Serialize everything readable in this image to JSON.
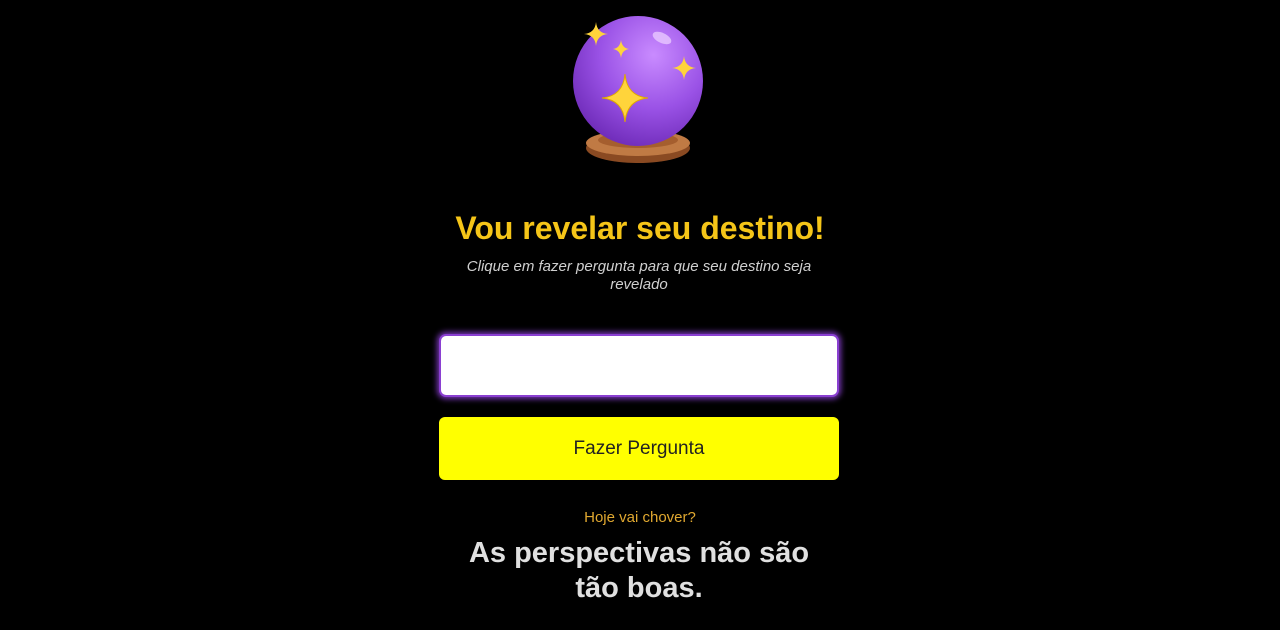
{
  "header": {
    "icon": "crystal-ball-icon",
    "title": "Vou revelar seu destino!",
    "subtitle": "Clique em fazer pergunta para que seu destino seja revelado"
  },
  "form": {
    "question_value": "",
    "question_placeholder": "",
    "button_label": "Fazer Pergunta"
  },
  "result": {
    "question": "Hoje vai chover?",
    "answer": "As perspectivas não são tão boas."
  },
  "colors": {
    "background": "#000000",
    "title": "#f5c518",
    "button": "#ffff00",
    "input_glow": "#8a3fd1",
    "question_text": "#e0a830",
    "answer_text": "#e0e0e0"
  }
}
